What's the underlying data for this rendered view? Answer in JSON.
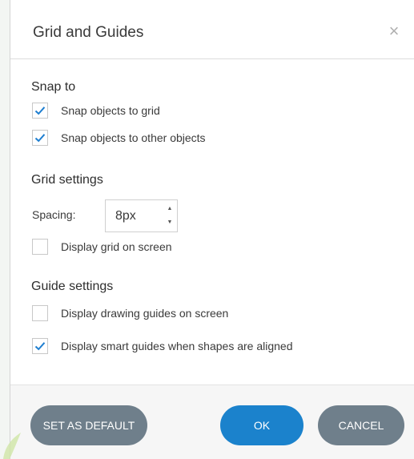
{
  "dialog": {
    "title": "Grid and Guides",
    "close_glyph": "×"
  },
  "snap": {
    "title": "Snap to",
    "options": [
      {
        "label": "Snap objects to grid",
        "checked": true
      },
      {
        "label": "Snap objects to other objects",
        "checked": true
      }
    ]
  },
  "grid": {
    "title": "Grid settings",
    "spacing_label": "Spacing:",
    "spacing_value": "8px",
    "display_grid": {
      "label": "Display grid on screen",
      "checked": false
    }
  },
  "guides": {
    "title": "Guide settings",
    "options": [
      {
        "label": "Display drawing guides on screen",
        "checked": false
      },
      {
        "label": "Display smart guides when shapes are aligned",
        "checked": true
      }
    ]
  },
  "buttons": {
    "set_default": "SET AS DEFAULT",
    "ok": "OK",
    "cancel": "CANCEL"
  },
  "colors": {
    "check": "#1e7ed0",
    "primary": "#1b82cc",
    "secondary": "#6f7f8b"
  }
}
